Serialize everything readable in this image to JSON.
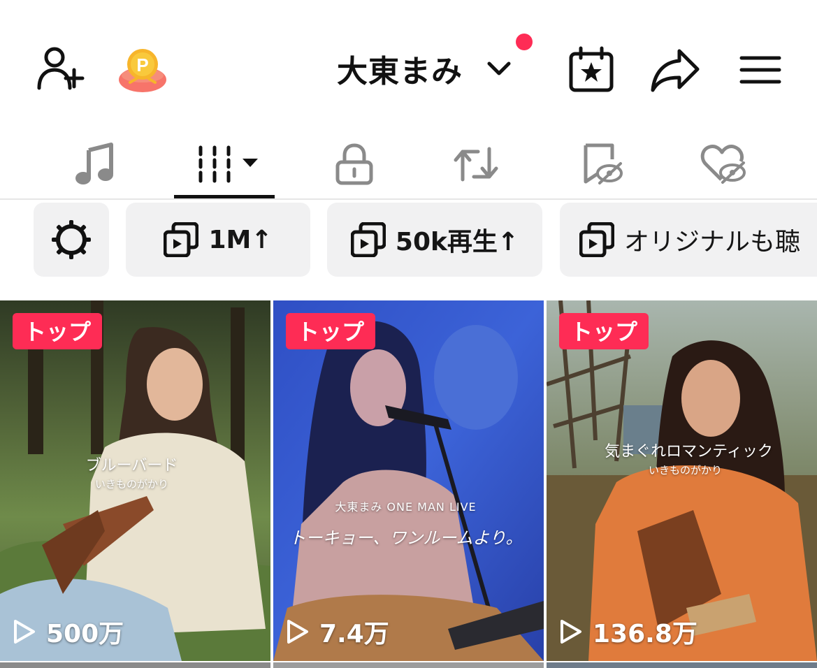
{
  "header": {
    "account_name": "大東まみ",
    "icons": [
      "add-user-icon",
      "points-icon",
      "chevron-down-icon",
      "notification-dot",
      "calendar-star-icon",
      "share-icon",
      "menu-icon"
    ],
    "accent_color": "#fe2c55"
  },
  "tabs": [
    {
      "name": "music-tab",
      "icon": "music-note-icon"
    },
    {
      "name": "videos-tab",
      "icon": "grid-bars-icon",
      "selected": true
    },
    {
      "name": "private-tab",
      "icon": "lock-icon"
    },
    {
      "name": "reposts-tab",
      "icon": "repost-icon"
    },
    {
      "name": "favorites-tab",
      "icon": "bookmark-hidden-icon"
    },
    {
      "name": "liked-tab",
      "icon": "heart-hidden-icon"
    }
  ],
  "filters": {
    "settings_icon": "gear-icon",
    "chips": [
      {
        "label": "1M↑"
      },
      {
        "label": "50k再生↑"
      },
      {
        "label": "オリジナルも聴"
      }
    ]
  },
  "videos": [
    {
      "badge": "トップ",
      "views": "500万",
      "overlay_title": "ブルーバード",
      "overlay_sub": "いきものがかり"
    },
    {
      "badge": "トップ",
      "views": "7.4万",
      "overlay_title": "大東まみ ONE MAN LIVE",
      "overlay_sub": "トーキョー、ワンルームより。"
    },
    {
      "badge": "トップ",
      "views": "136.8万",
      "overlay_title": "気まぐれロマンティック",
      "overlay_sub": "いきものがかり"
    }
  ]
}
